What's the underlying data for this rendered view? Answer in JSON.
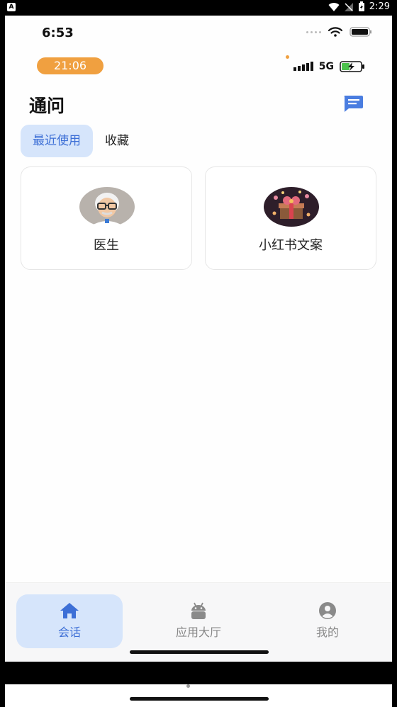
{
  "android_status": {
    "badge": "A",
    "time": "2:29"
  },
  "ios_status": {
    "time": "6:53"
  },
  "inner_status": {
    "time": "21:06",
    "network": "5G"
  },
  "header": {
    "title": "通问"
  },
  "tabs": [
    {
      "label": "最近使用",
      "active": true
    },
    {
      "label": "收藏",
      "active": false
    }
  ],
  "cards": [
    {
      "name": "医生",
      "avatar": "doctor-avatar-icon"
    },
    {
      "name": "小红书文案",
      "avatar": "gift-box-avatar-icon"
    }
  ],
  "bottom_nav": [
    {
      "label": "会话",
      "icon": "home-icon",
      "active": true
    },
    {
      "label": "应用大厅",
      "icon": "android-icon",
      "active": false
    },
    {
      "label": "我的",
      "icon": "person-icon",
      "active": false
    }
  ],
  "colors": {
    "accent": "#3d6fd6",
    "accent_bg": "#d6e5fb",
    "pill": "#f0a040"
  }
}
